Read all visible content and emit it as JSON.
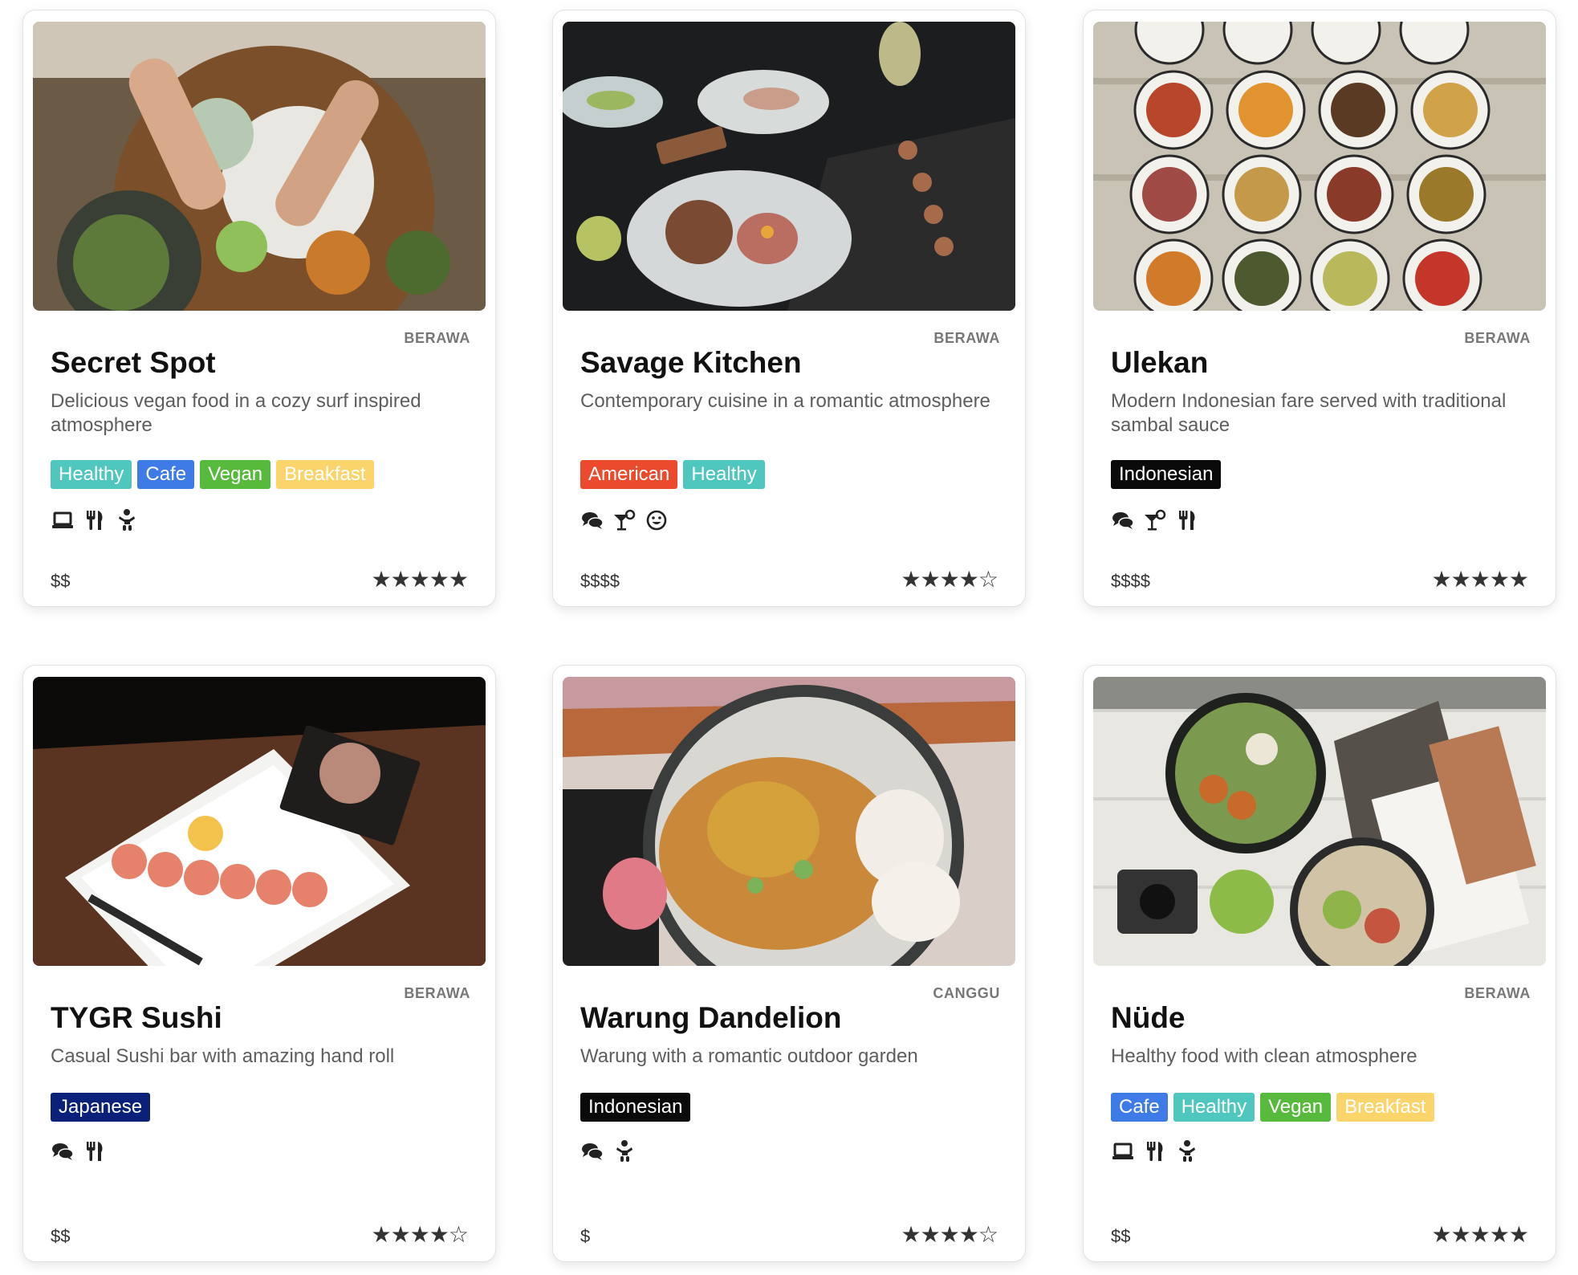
{
  "cards": [
    {
      "area": "BERAWA",
      "name": "Secret Spot",
      "description": "Delicious vegan food in a cozy surf inspired atmosphere",
      "tags": [
        "Healthy",
        "Cafe",
        "Vegan",
        "Breakfast"
      ],
      "amenities": [
        "laptop-icon",
        "utensils-icon",
        "child-icon"
      ],
      "price": "$$",
      "rating": 5
    },
    {
      "area": "BERAWA",
      "name": "Savage Kitchen",
      "description": "Contemporary cuisine in a romantic atmosphere",
      "tags": [
        "American",
        "Healthy"
      ],
      "amenities": [
        "comments-icon",
        "cocktail-icon",
        "smile-icon"
      ],
      "price": "$$$$",
      "rating": 4
    },
    {
      "area": "BERAWA",
      "name": "Ulekan",
      "description": "Modern Indonesian fare served with traditional sambal sauce",
      "tags": [
        "Indonesian"
      ],
      "amenities": [
        "comments-icon",
        "cocktail-icon",
        "utensils-icon"
      ],
      "price": "$$$$",
      "rating": 5
    },
    {
      "area": "BERAWA",
      "name": "TYGR Sushi",
      "description": "Casual Sushi bar with amazing hand roll",
      "tags": [
        "Japanese"
      ],
      "amenities": [
        "comments-icon",
        "utensils-icon"
      ],
      "price": "$$",
      "rating": 4
    },
    {
      "area": "CANGGU",
      "name": "Warung Dandelion",
      "description": "Warung with a romantic outdoor garden",
      "tags": [
        "Indonesian"
      ],
      "amenities": [
        "comments-icon",
        "child-icon"
      ],
      "price": "$",
      "rating": 4
    },
    {
      "area": "BERAWA",
      "name": "Nüde",
      "description": "Healthy food with clean atmosphere",
      "tags": [
        "Cafe",
        "Healthy",
        "Vegan",
        "Breakfast"
      ],
      "amenities": [
        "laptop-icon",
        "utensils-icon",
        "child-icon"
      ],
      "price": "$$",
      "rating": 5
    }
  ],
  "colors": {
    "healthy": "#4fc7bf",
    "cafe": "#3f7be6",
    "vegan": "#57ba3c",
    "breakfast": "#fbd56c",
    "american": "#eb4a2c",
    "indonesian": "#0a0a0a",
    "japanese": "#0b2179"
  }
}
